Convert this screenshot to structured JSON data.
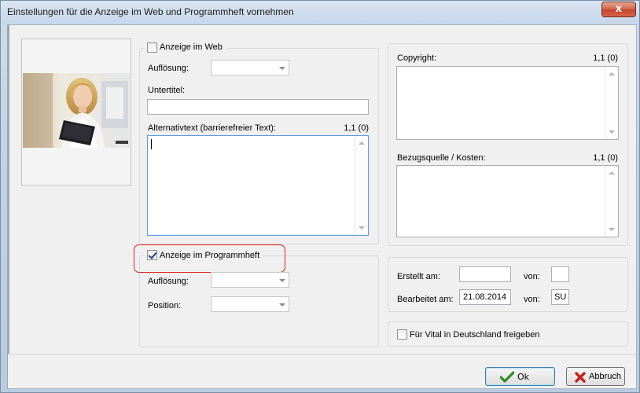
{
  "window": {
    "title": "Einstellungen für die Anzeige im Web und Programmheft vornehmen",
    "close_symbol": "x"
  },
  "web_group": {
    "checkbox_label": "Anzeige im Web",
    "checked": false,
    "resolution_label": "Auflösung:",
    "resolution_value": "",
    "subtitle_label": "Untertitel:",
    "subtitle_value": "",
    "alt_text_label": "Alternativtext (barrierefreier Text):",
    "alt_text_counter": "1,1 (0)",
    "alt_text_value": ""
  },
  "program_group": {
    "checkbox_label": "Anzeige im Programmheft",
    "checked": true,
    "resolution_label": "Auflösung:",
    "resolution_value": "",
    "position_label": "Position:",
    "position_value": ""
  },
  "copyright_group": {
    "copyright_label": "Copyright:",
    "copyright_counter": "1,1 (0)",
    "copyright_value": "",
    "source_label": "Bezugsquelle / Kosten:",
    "source_counter": "1,1 (0)",
    "source_value": ""
  },
  "meta_group": {
    "created_label": "Erstellt am:",
    "created_date": "",
    "created_by_label": "von:",
    "created_by": "",
    "edited_label": "Bearbeitet am:",
    "edited_date": "21.08.2014",
    "edited_by_label": "von:",
    "edited_by": "SU"
  },
  "vital": {
    "checkbox_label": "Für Vital in Deutschland freigeben",
    "checked": false
  },
  "buttons": {
    "ok_label": "Ok",
    "cancel_label": "Abbruch"
  },
  "colors": {
    "highlight": "#e02020",
    "ok_check": "#2e8b20",
    "cancel_x": "#c8201a"
  },
  "icons": {
    "ok": "checkmark-icon",
    "cancel": "cross-icon"
  }
}
